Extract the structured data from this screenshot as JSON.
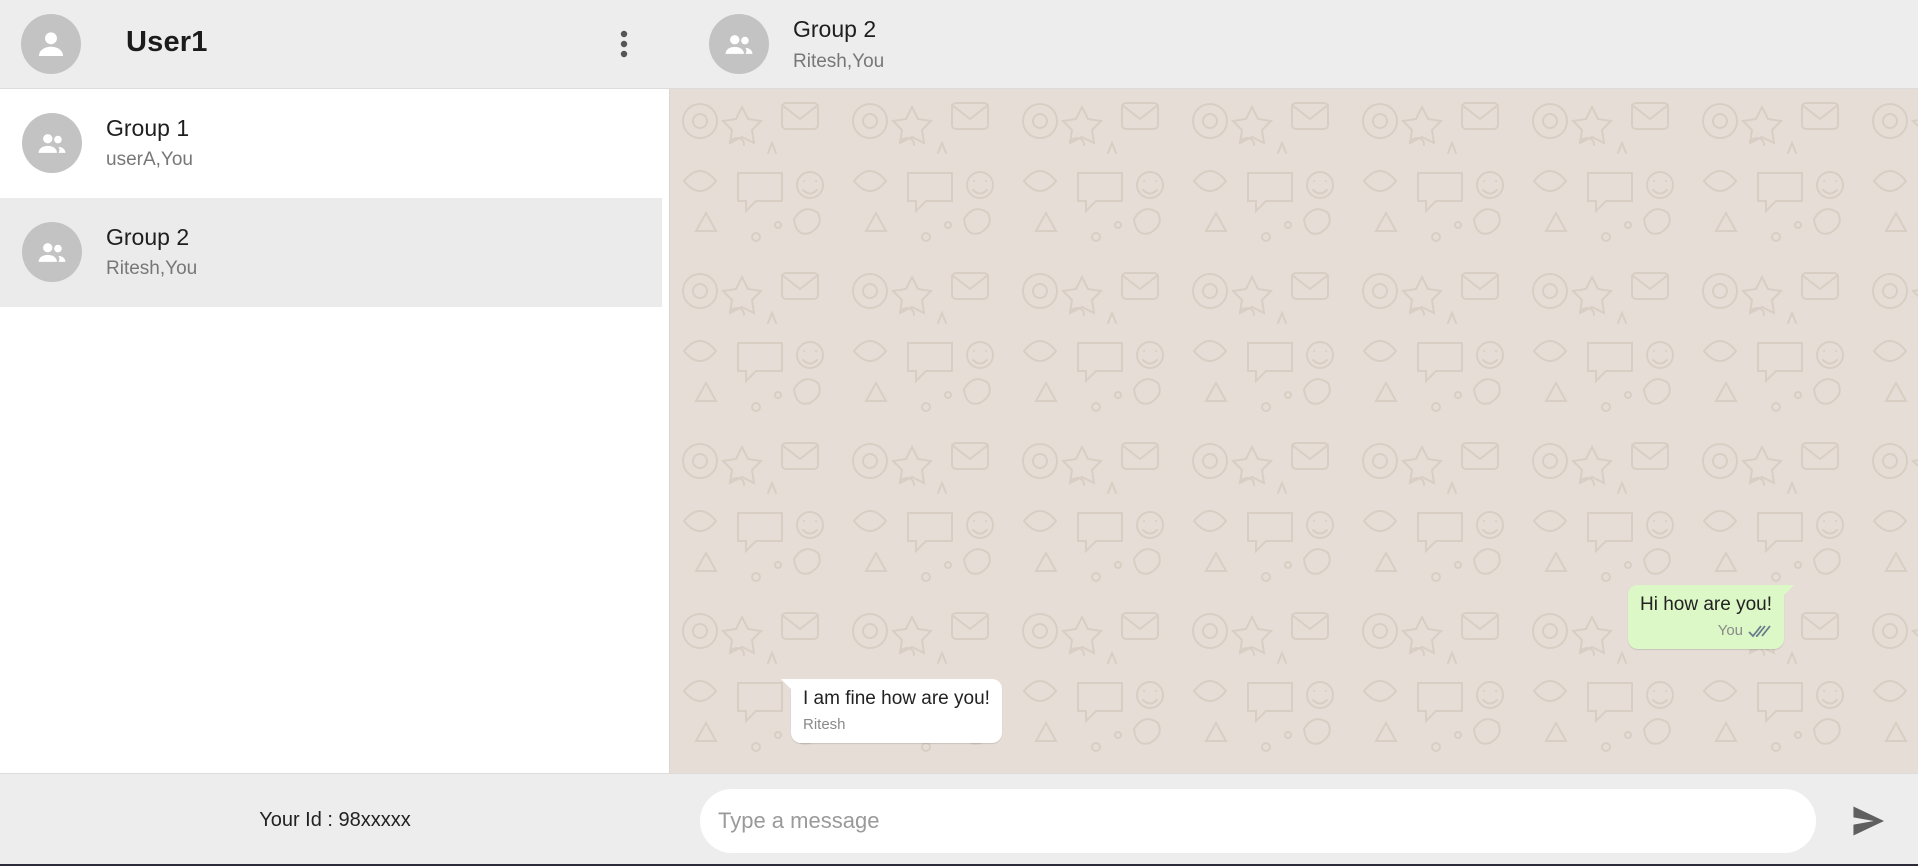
{
  "sidebar": {
    "user_name": "User1",
    "menu_icon": "more-vertical-icon",
    "chats": [
      {
        "name": "Group 1",
        "members": "userA,You",
        "active": false,
        "icon": "group-icon"
      },
      {
        "name": "Group 2",
        "members": "Ritesh,You",
        "active": true,
        "icon": "group-icon"
      }
    ],
    "footer_text": "Your Id : 98xxxxx"
  },
  "chat": {
    "title": "Group 2",
    "subtitle": "Ritesh,You",
    "messages": [
      {
        "direction": "outgoing",
        "text": "Hi how are you!",
        "sender": "You",
        "status_icon": "double-check-icon"
      },
      {
        "direction": "incoming",
        "text": "I am fine how are you!",
        "sender": "Ritesh"
      }
    ],
    "input": {
      "placeholder": "Type a message",
      "value": ""
    },
    "send_icon": "send-icon"
  },
  "colors": {
    "header_bg": "#ededed",
    "active_chat_bg": "#ebebeb",
    "wallpaper_bg": "#e6ded6",
    "outgoing_bubble": "#dcf8c6",
    "incoming_bubble": "#ffffff",
    "avatar_bg": "#c3c3c3",
    "read_tick": "#6b7b8c"
  }
}
